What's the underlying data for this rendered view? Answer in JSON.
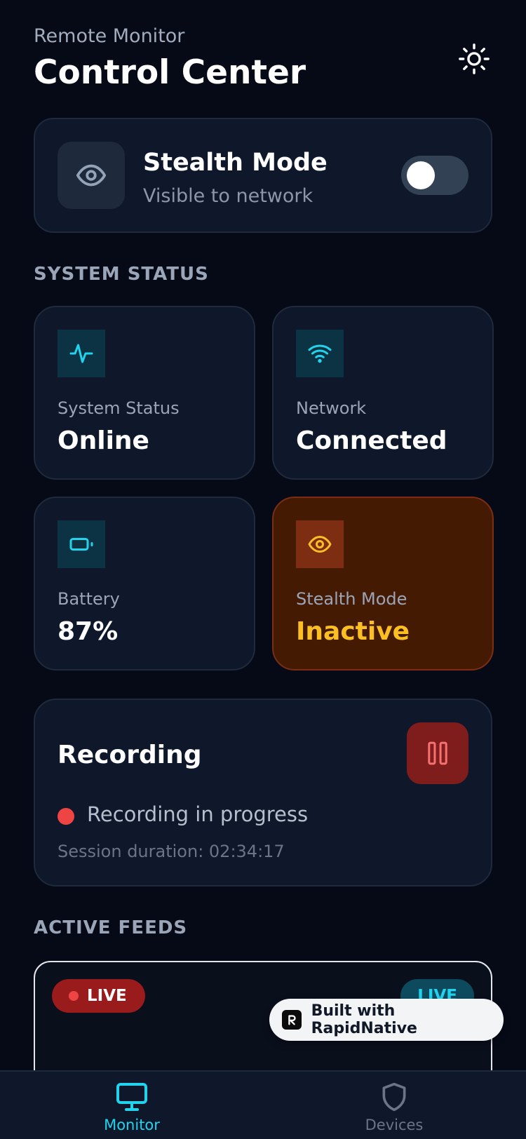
{
  "header": {
    "subtitle": "Remote Monitor",
    "title": "Control Center",
    "theme_icon": "sun-icon"
  },
  "stealth": {
    "title": "Stealth Mode",
    "subtitle": "Visible to network",
    "icon": "eye-icon",
    "enabled": false
  },
  "sections": {
    "system_status": "SYSTEM STATUS",
    "active_feeds": "ACTIVE FEEDS"
  },
  "stats": [
    {
      "label": "System Status",
      "value": "Online",
      "icon": "activity-icon"
    },
    {
      "label": "Network",
      "value": "Connected",
      "icon": "wifi-icon"
    },
    {
      "label": "Battery",
      "value": "87%",
      "icon": "battery-icon"
    },
    {
      "label": "Stealth Mode",
      "value": "Inactive",
      "icon": "eye-icon"
    }
  ],
  "recording": {
    "title": "Recording",
    "status": "Recording in progress",
    "duration": "Session duration: 02:34:17",
    "pause_icon": "pause-icon"
  },
  "feeds": {
    "badge_1": "LIVE",
    "badge_2": "LIVE"
  },
  "built_with": "Built with RapidNative",
  "nav": [
    {
      "label": "Monitor",
      "icon": "monitor-icon",
      "active": true
    },
    {
      "label": "Devices",
      "icon": "shield-icon",
      "active": false
    }
  ],
  "colors": {
    "background": "#060a17",
    "card": "#0f172a",
    "accent": "#22d3ee",
    "warning": "#fbbf24",
    "danger": "#ef4444"
  }
}
